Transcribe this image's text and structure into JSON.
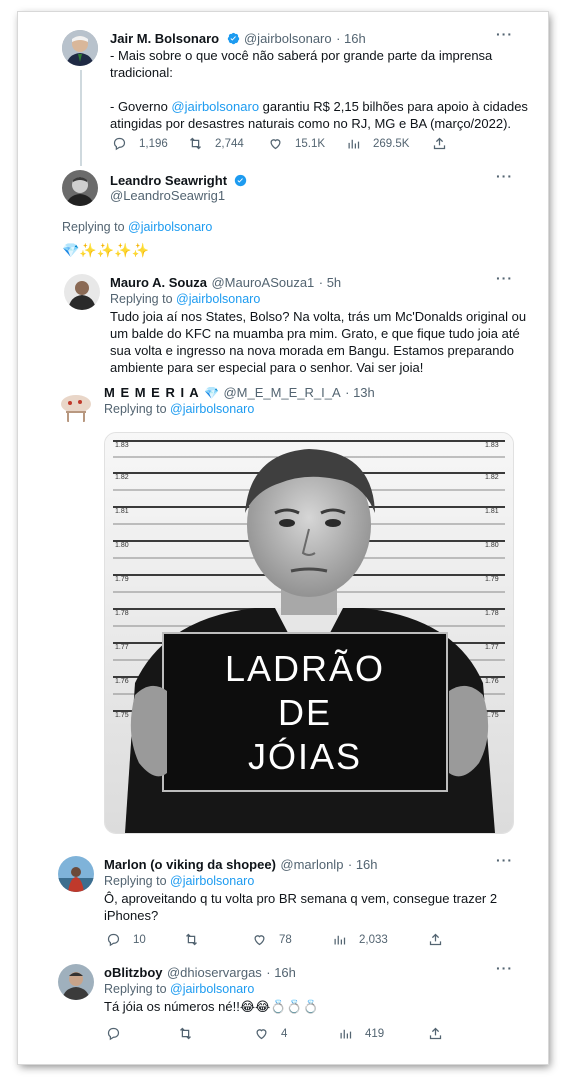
{
  "tweets": [
    {
      "name": "Jair M. Bolsonaro",
      "handle": "@jairbolsonaro",
      "time": "· 16h",
      "line1": "- Mais sobre o que você não saberá por grande parte da imprensa",
      "line2": "tradicional:",
      "line3_pre": "- Governo ",
      "line3_link": "@jairbolsonaro",
      "line3_post": " garantiu R$ 2,15 bilhões para apoio à cidades",
      "line4": "atingidas por desastres naturais como no RJ, MG e BA (março/2022).",
      "replies": "1,196",
      "retweets": "2,744",
      "likes": "15.1K",
      "views": "269.5K"
    },
    {
      "name": "Leandro Seawright",
      "handle": "@LeandroSeawrig1",
      "replying_prefix": "Replying to ",
      "replying_to": "@jairbolsonaro",
      "text": "💎✨✨✨✨"
    },
    {
      "name": "Mauro A. Souza",
      "handle": "@MauroASouza1",
      "time": "· 5h",
      "replying_prefix": "Replying to ",
      "replying_to": "@jairbolsonaro",
      "line1": "Tudo joia aí nos States, Bolso? Na volta, trás um Mc'Donalds original ou",
      "line2": "um balde do KFC na muamba pra mim. Grato, e que fique tudo joia até",
      "line3": "sua volta e ingresso na nova morada em Bangu. Estamos preparando",
      "line4": "ambiente para ser especial para o senhor. Vai ser joia!"
    },
    {
      "name": "M E M E R I A",
      "name_emoji": "💎",
      "handle": "@M_E_M_E_R_I_A",
      "time": "· 13h",
      "replying_prefix": "Replying to ",
      "replying_to": "@jairbolsonaro",
      "image_sign_line1": "LADRÃO",
      "image_sign_line2": "DE",
      "image_sign_line3": "JÓIAS",
      "height_marks": [
        "1.83",
        "1.82",
        "1.81",
        "1.80",
        "1.79",
        "1.78",
        "1.77",
        "1.76",
        "1.75"
      ]
    },
    {
      "name": "Marlon (o viking da shopee)",
      "handle": "@marlonlp",
      "time": "· 16h",
      "replying_prefix": "Replying to ",
      "replying_to": "@jairbolsonaro",
      "line1": "Ô, aproveitando q tu volta pro BR semana q vem, consegue trazer 2",
      "line2": "iPhones?",
      "replies": "10",
      "retweets": "",
      "likes": "78",
      "views": "2,033"
    },
    {
      "name": "oBlitzboy",
      "handle": "@dhioservargas",
      "time": "· 16h",
      "replying_prefix": "Replying to ",
      "replying_to": "@jairbolsonaro",
      "text": "Tá jóia os números né!!😂😂💍💍💍",
      "replies": "",
      "retweets": "",
      "likes": "4",
      "views": "419"
    }
  ],
  "colors": {
    "link": "#1d9bf0",
    "secondary": "#536471",
    "verified": "#1d9bf0"
  },
  "icons": [
    "reply-icon",
    "retweet-icon",
    "like-icon",
    "views-icon",
    "share-icon",
    "more-icon",
    "verified-icon"
  ]
}
